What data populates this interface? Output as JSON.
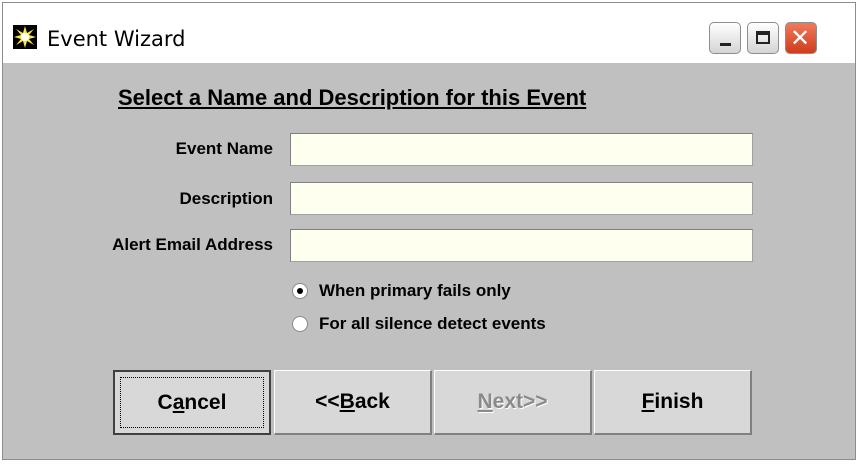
{
  "window": {
    "title": "Event Wizard",
    "icon": "starburst-icon",
    "buttons": {
      "minimize": "minimize-icon",
      "maximize": "maximize-icon",
      "close": "close-icon"
    }
  },
  "form": {
    "heading": "Select a Name and Description for this Event",
    "fields": [
      {
        "label": "Event Name",
        "value": "",
        "placeholder": ""
      },
      {
        "label": "Description",
        "value": "",
        "placeholder": ""
      },
      {
        "label": "Alert Email Address",
        "value": "",
        "placeholder": ""
      }
    ],
    "radios": [
      {
        "label": "When primary fails only",
        "checked": true
      },
      {
        "label": "For all silence detect events",
        "checked": false
      }
    ]
  },
  "buttons": {
    "cancel": {
      "label": "Cancel",
      "mnemonic": "a",
      "enabled": true
    },
    "back": {
      "label": "<<Back",
      "mnemonic": "B",
      "enabled": true
    },
    "next": {
      "label": "Next>>",
      "mnemonic": "N",
      "enabled": false
    },
    "finish": {
      "label": "Finish",
      "mnemonic": "F",
      "enabled": true
    }
  },
  "colors": {
    "dialog_bg": "#c0c0c0",
    "input_bg": "#fffff0",
    "close_button": "#d9492a"
  }
}
